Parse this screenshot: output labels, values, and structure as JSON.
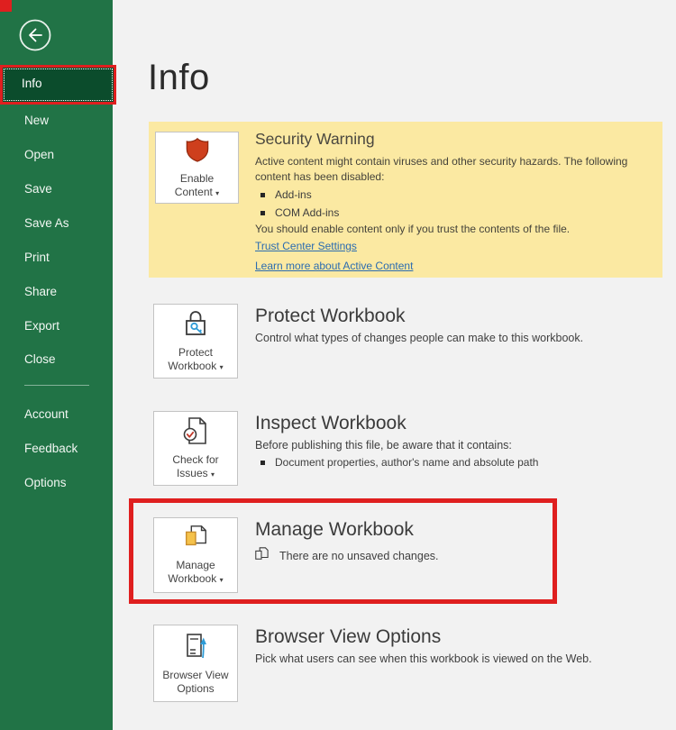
{
  "colors": {
    "sidebar_green": "#217346",
    "selected_green": "#0b4c2c",
    "annotation_red": "#df1f1f",
    "warning_bg": "#fbe9a2",
    "link_blue": "#2b6cb0",
    "icon_blue": "#2e9bd6",
    "shield_red": "#ce3f1d",
    "doc_yellow": "#f5c24b",
    "text_dark": "#3b3b3b",
    "content_bg": "#f2f2f2",
    "button_border": "#c3c3c3"
  },
  "ui": {
    "caret": "▾"
  },
  "sidebar": {
    "selected_item": "Info",
    "items": [
      "New",
      "Open",
      "Save",
      "Save As",
      "Print",
      "Share",
      "Export",
      "Close"
    ],
    "bottom_items": [
      "Account",
      "Feedback",
      "Options"
    ]
  },
  "main": {
    "title": "Info",
    "security": {
      "button": {
        "line1": "Enable",
        "line2": "Content"
      },
      "heading": "Security Warning",
      "body_lines": [
        "Active content might contain viruses and other security hazards. The following",
        "content has been disabled:"
      ],
      "bullets": [
        "Add-ins",
        "COM Add-ins"
      ],
      "note": "You should enable content only if you trust the contents of the file.",
      "links": [
        "Trust Center Settings",
        "Learn more about Active Content"
      ]
    },
    "sections": [
      {
        "button_line1": "Protect",
        "button_line2": "Workbook",
        "heading": "Protect Workbook",
        "desc": "Control what types of changes people can make to this workbook."
      },
      {
        "button_line1": "Check for",
        "button_line2": "Issues",
        "heading": "Inspect Workbook",
        "desc": "Before publishing this file, be aware that it contains:",
        "bullet": "Document properties, author's name and absolute path"
      },
      {
        "button_line1": "Manage",
        "button_line2": "Workbook",
        "heading": "Manage Workbook",
        "status": "There are no unsaved changes."
      },
      {
        "button_line1": "Browser View",
        "button_line2": "Options",
        "heading": "Browser View Options",
        "desc": "Pick what users can see when this workbook is viewed on the Web."
      }
    ]
  }
}
